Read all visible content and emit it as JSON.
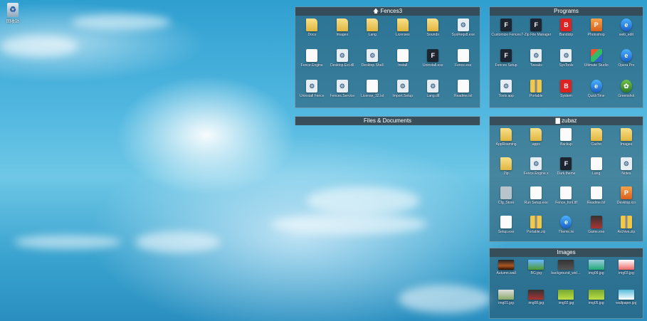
{
  "desktop": {
    "recycle_bin_label": "回收站"
  },
  "fences": [
    {
      "id": "fences3",
      "title": "Fences3",
      "title_icon": "up-arrow-icon",
      "items": [
        {
          "label": "Docs",
          "icon": "folder"
        },
        {
          "label": "Images",
          "icon": "folder"
        },
        {
          "label": "Lang",
          "icon": "folder"
        },
        {
          "label": "Licenses",
          "icon": "folder"
        },
        {
          "label": "Sounds",
          "icon": "folder"
        },
        {
          "label": "SysReqs8.exe",
          "icon": "gear"
        },
        {
          "label": "Fence.Engine",
          "icon": "doc"
        },
        {
          "label": "Desktop.Ext.dll",
          "icon": "gear"
        },
        {
          "label": "Desktop.Shell",
          "icon": "gear"
        },
        {
          "label": "Install",
          "icon": "doc"
        },
        {
          "label": "Uninstall.exe",
          "icon": "dark"
        },
        {
          "label": "Fence.exe",
          "icon": "doc"
        },
        {
          "label": "Uninstall Fence",
          "icon": "gear"
        },
        {
          "label": "Fences.Service",
          "icon": "gear"
        },
        {
          "label": "License_32.txt",
          "icon": "doc"
        },
        {
          "label": "Import.Setup",
          "icon": "gear"
        },
        {
          "label": "Lang.dll",
          "icon": "gear"
        },
        {
          "label": "Readme.txt",
          "icon": "doc"
        }
      ]
    },
    {
      "id": "files-documents",
      "title": "Files & Documents",
      "items": []
    },
    {
      "id": "programs",
      "title": "Programs",
      "items": [
        {
          "label": "Customize Fences",
          "icon": "dark"
        },
        {
          "label": "7-Zip File Manager",
          "icon": "dark"
        },
        {
          "label": "Bandizip",
          "icon": "red"
        },
        {
          "label": "Photoshop",
          "icon": "orange"
        },
        {
          "label": "web_edit",
          "icon": "blue"
        },
        {
          "label": "Fences Setup",
          "icon": "dark"
        },
        {
          "label": "Tweaks",
          "icon": "gear"
        },
        {
          "label": "SysTools",
          "icon": "gear"
        },
        {
          "label": "Ultimate Studio",
          "icon": "cube"
        },
        {
          "label": "Opera Pro",
          "icon": "blue"
        },
        {
          "label": "Tools app",
          "icon": "gear"
        },
        {
          "label": "Portable",
          "icon": "zip"
        },
        {
          "label": "System",
          "icon": "red"
        },
        {
          "label": "QuickTime",
          "icon": "blue"
        },
        {
          "label": "Greenshot",
          "icon": "green"
        }
      ]
    },
    {
      "id": "zubaz",
      "title": "zubaz",
      "title_icon": "folder-icon",
      "items": [
        {
          "label": "AppRoaming",
          "icon": "folder"
        },
        {
          "label": "apps",
          "icon": "folder"
        },
        {
          "label": "Backup",
          "icon": "doc"
        },
        {
          "label": "Cache",
          "icon": "folder"
        },
        {
          "label": "Images",
          "icon": "folder"
        },
        {
          "label": "Zip",
          "icon": "folder"
        },
        {
          "label": "Fence.Engine.x",
          "icon": "gear"
        },
        {
          "label": "Dark.theme",
          "icon": "dark"
        },
        {
          "label": "Lang",
          "icon": "doc"
        },
        {
          "label": "Notes",
          "icon": "gear"
        },
        {
          "label": "Cfg_Store",
          "icon": "grey"
        },
        {
          "label": "Run Setup.exe",
          "icon": "doc"
        },
        {
          "label": "Fence_font.ttf",
          "icon": "doc"
        },
        {
          "label": "Readme.txt",
          "icon": "doc"
        },
        {
          "label": "Desktop.ico",
          "icon": "orange"
        },
        {
          "label": "Setup.exe",
          "icon": "doc"
        },
        {
          "label": "Portable.zip",
          "icon": "zip"
        },
        {
          "label": "Theme.ini",
          "icon": "blue"
        },
        {
          "label": "Game.exe",
          "icon": "img9"
        },
        {
          "label": "Archive.zip",
          "icon": "zip"
        }
      ]
    },
    {
      "id": "images",
      "title": "Images",
      "items": [
        {
          "label": "Autumn.wall",
          "icon": "img1"
        },
        {
          "label": "BG.jpg",
          "icon": "img2"
        },
        {
          "label": "background_wide.jpg",
          "icon": "img3"
        },
        {
          "label": "img09.jpg",
          "icon": "img4"
        },
        {
          "label": "img03.jpg",
          "icon": "img5"
        },
        {
          "label": "img01.jpg",
          "icon": "img6"
        },
        {
          "label": "img08.jpg",
          "icon": "img9"
        },
        {
          "label": "img02.jpg",
          "icon": "img7"
        },
        {
          "label": "img05.jpg",
          "icon": "img7"
        },
        {
          "label": "wallpaper.jpg",
          "icon": "img8"
        }
      ]
    }
  ]
}
